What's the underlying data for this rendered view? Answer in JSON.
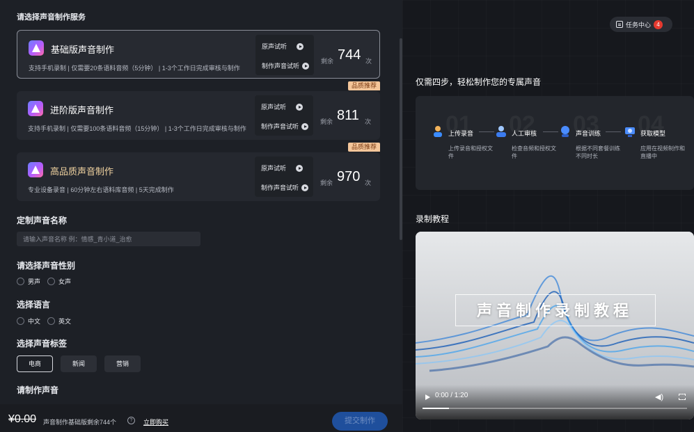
{
  "service_section": {
    "title": "请选择声音制作服务"
  },
  "services": [
    {
      "title": "基础版声音制作",
      "desc": "支持手机录制 | 仅需要20条语料音频（5分钟） | 1-3个工作日完成审核与制作",
      "action1": "原声试听",
      "action2": "制作声音试听",
      "remain_label": "剩余",
      "remain_count": "744",
      "remain_unit": "次",
      "badge": "",
      "selected": true
    },
    {
      "title": "进阶版声音制作",
      "desc": "支持手机录制 | 仅需要100条语料音频（15分钟） | 1-3个工作日完成审核与制作",
      "action1": "原声试听",
      "action2": "制作声音试听",
      "remain_label": "剩余",
      "remain_count": "811",
      "remain_unit": "次",
      "badge": "品质推荐",
      "selected": false
    },
    {
      "title": "高品质声音制作",
      "desc": "专业设备录音 | 60分钟左右语料库音频 | 5天完成制作",
      "action1": "原声试听",
      "action2": "制作声音试听",
      "remain_label": "剩余",
      "remain_count": "970",
      "remain_unit": "次",
      "badge": "品质推荐",
      "selected": false
    }
  ],
  "name_section": {
    "title": "定制声音名称",
    "placeholder": "请输入声音名称 例：情感_青小道_治愈",
    "value": ""
  },
  "gender_section": {
    "title": "请选择声音性别",
    "options": [
      "男声",
      "女声"
    ]
  },
  "language_section": {
    "title": "选择语言",
    "options": [
      "中文",
      "英文"
    ]
  },
  "tag_section": {
    "title": "选择声音标签",
    "tags": [
      "电商",
      "新闻",
      "营销"
    ],
    "active": "电商"
  },
  "make_section": {
    "title": "请制作声音"
  },
  "footer": {
    "price": "¥0.00",
    "note": "声音制作基础版剩余744个",
    "help_icon": "?",
    "buy_link": "立即购买",
    "submit": "提交制作"
  },
  "task_center": {
    "label": "任务中心",
    "count": "4"
  },
  "steps": {
    "heading": "仅需四步，轻松制作您的专属声音",
    "items": [
      {
        "num": "01",
        "name": "上传录音",
        "desc": "上传录音和授权文件",
        "icon": "upload-person-icon"
      },
      {
        "num": "02",
        "name": "人工审核",
        "desc": "检查音频和授权文件",
        "icon": "review-person-icon"
      },
      {
        "num": "03",
        "name": "声音训练",
        "desc": "根据不同套餐训练不同时长",
        "icon": "training-icon"
      },
      {
        "num": "04",
        "name": "获取模型",
        "desc": "应用在视频制作和直播中",
        "icon": "model-icon"
      }
    ]
  },
  "tutorial": {
    "heading": "录制教程",
    "video_title": "声音制作录制教程",
    "time": "0:00 / 1:20",
    "progress": 0.1
  },
  "colors": {
    "accent": "#1f4f9c",
    "badge": "#f4c69a",
    "task_badge": "#e5392f",
    "gold_title": "#f1d3a0"
  }
}
